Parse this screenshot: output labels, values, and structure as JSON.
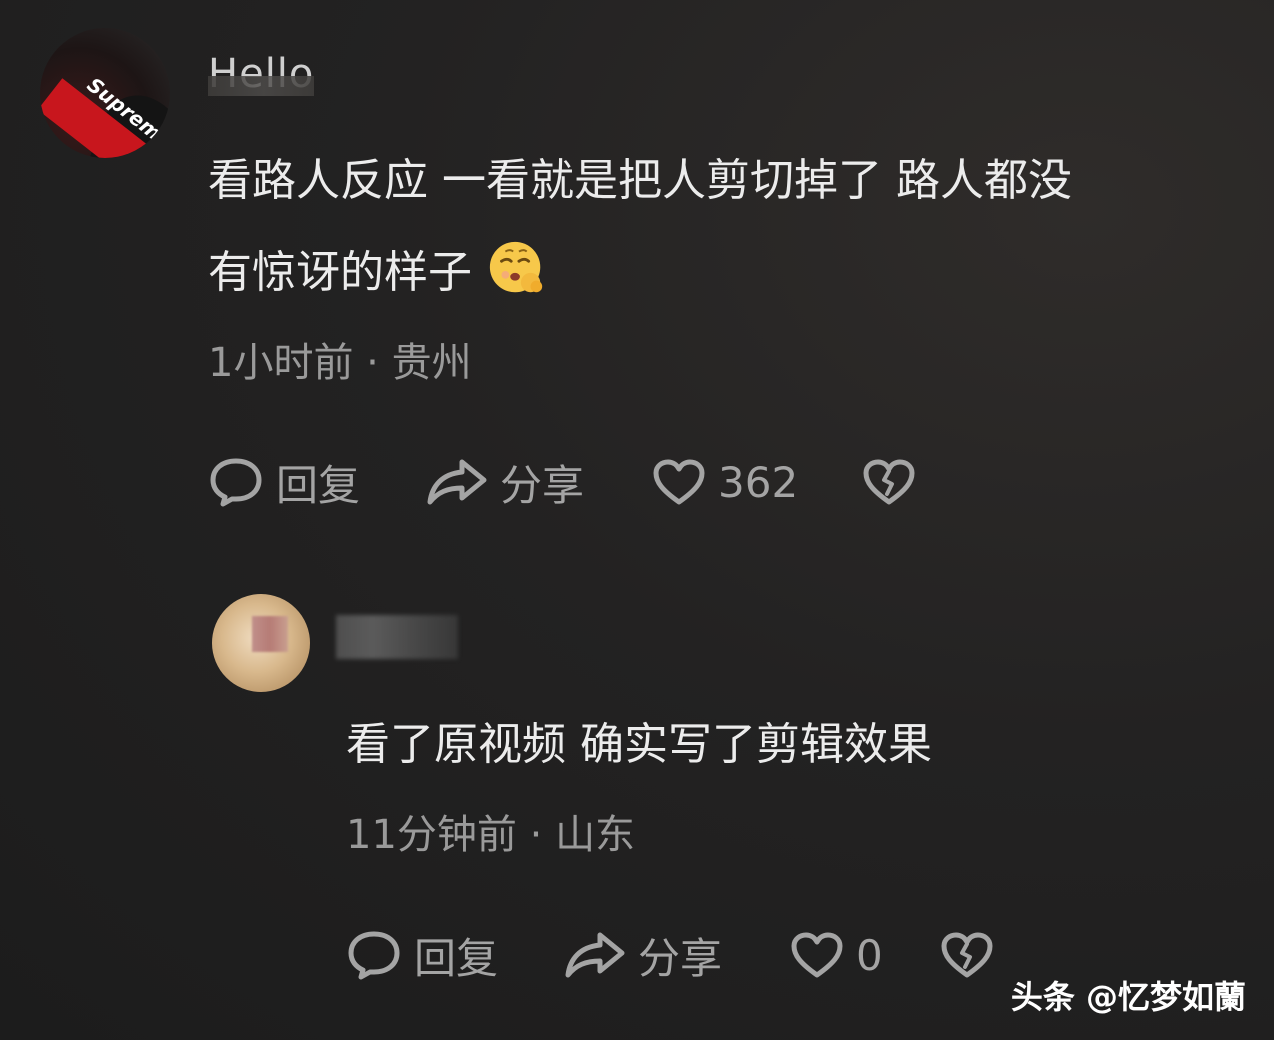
{
  "comment": {
    "username": "Hello",
    "avatar_icon": "supreme-avatar",
    "text_line_1": "看路人反应 一看就是把人剪切掉了 路人都没",
    "text_line_2": "有惊讶的样子",
    "emoji": "shushing-face-emoji",
    "time": "1小时前",
    "separator": "·",
    "location": "贵州",
    "actions": {
      "reply_label": "回复",
      "share_label": "分享",
      "like_count": "362"
    }
  },
  "reply": {
    "username": "",
    "avatar_icon": "dog-avatar",
    "text": "看了原视频 确实写了剪辑效果",
    "time": "11分钟前",
    "separator": "·",
    "location": "山东",
    "actions": {
      "reply_label": "回复",
      "share_label": "分享",
      "like_count": "0"
    }
  },
  "watermark": "头条 @忆梦如蘭",
  "colors": {
    "background": "#232222",
    "text": "#ececec",
    "meta": "#9a9a9a",
    "icon": "#a4a4a4"
  }
}
